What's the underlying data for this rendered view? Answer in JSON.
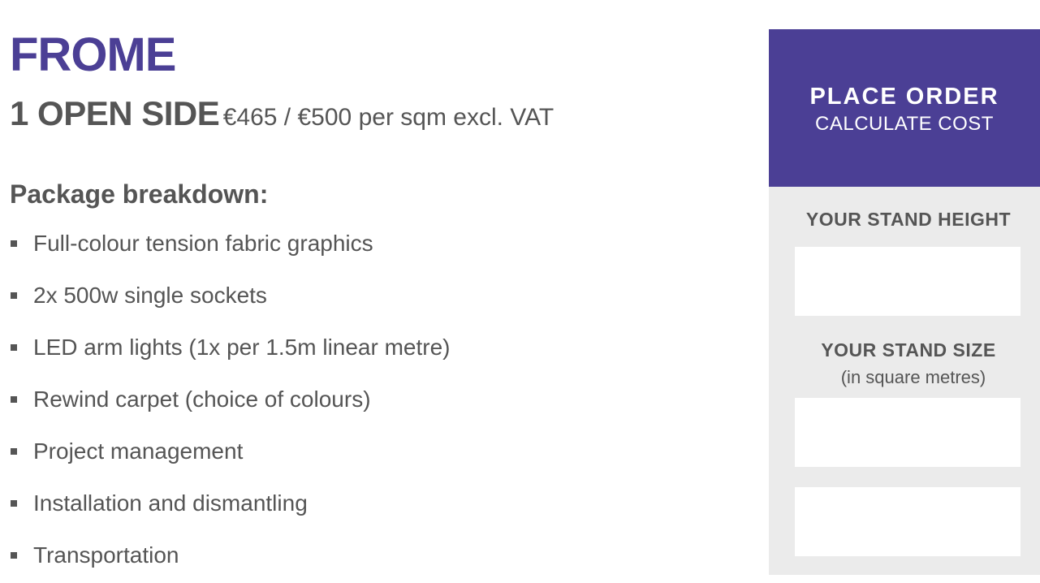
{
  "product": {
    "title": "FROME",
    "sides_label": "1 OPEN SIDE",
    "price_primary": "€465",
    "price_separator": " / ",
    "price_secondary": "€500",
    "price_unit": " per sqm excl. VAT"
  },
  "breakdown": {
    "heading": "Package breakdown:",
    "items": [
      "Full-colour tension fabric graphics",
      "2x 500w single sockets",
      "LED arm lights (1x per 1.5m linear metre)",
      "Rewind carpet (choice of colours)",
      "Project management",
      "Installation and dismantling",
      "Transportation"
    ]
  },
  "order_panel": {
    "title": "PLACE ORDER",
    "subtitle": "CALCULATE COST",
    "height_label": "YOUR STAND HEIGHT",
    "height_value": "",
    "size_label": "YOUR STAND SIZE",
    "size_hint": "(in square metres)",
    "size_value": "",
    "extra_value": ""
  },
  "colors": {
    "brand_purple": "#4b3f95",
    "text_gray": "#555555",
    "panel_bg": "#ebebeb"
  }
}
